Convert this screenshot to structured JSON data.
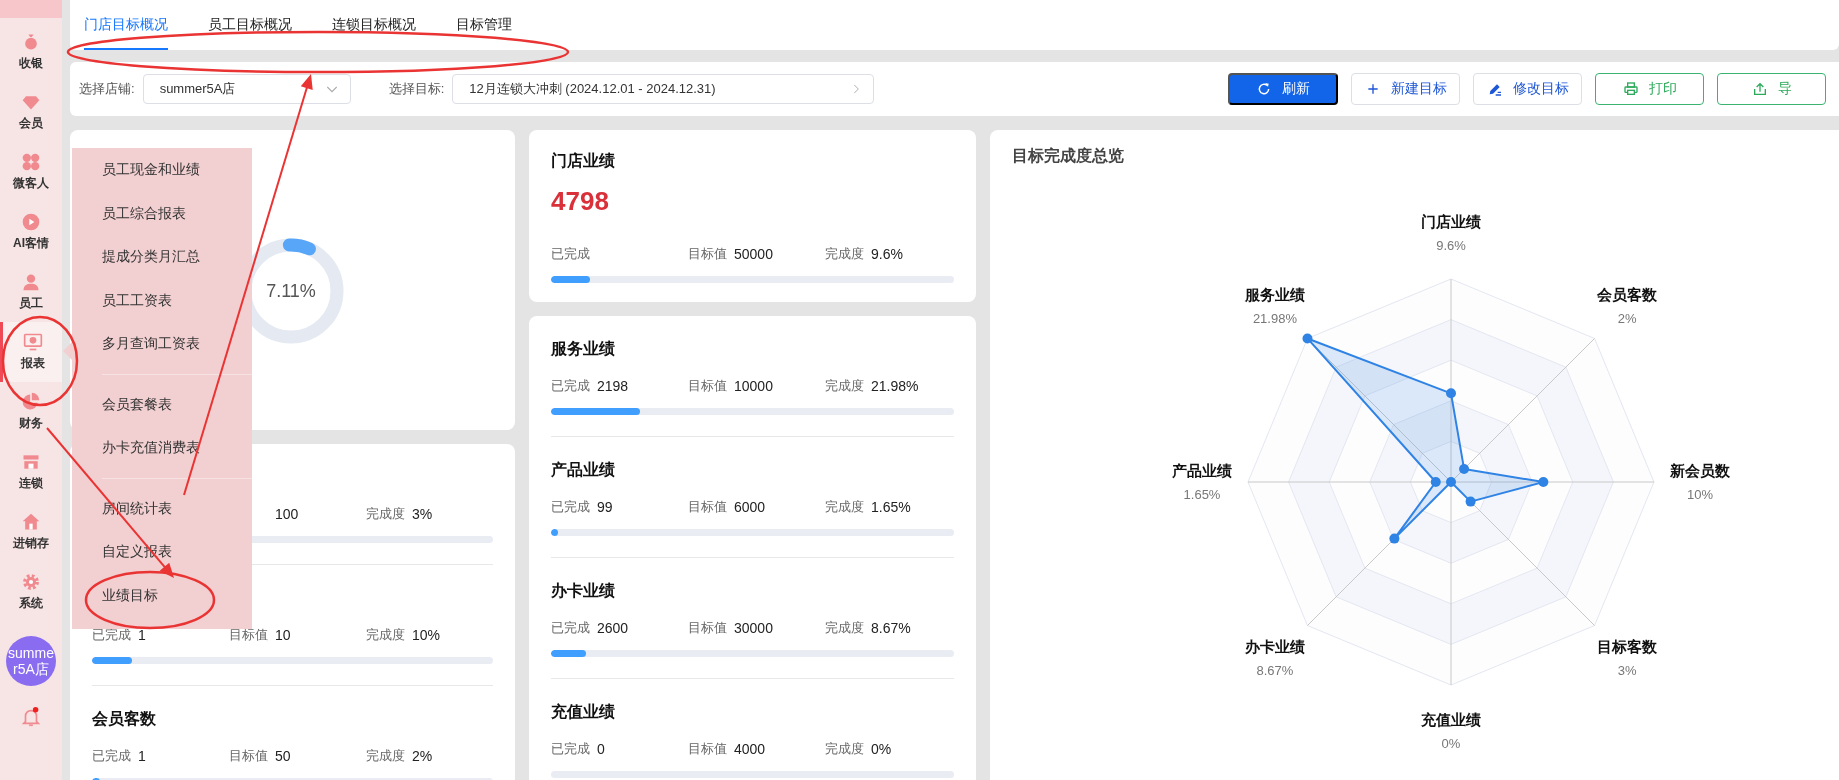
{
  "sidebar": {
    "items": [
      {
        "label": "收银",
        "selected": false
      },
      {
        "label": "会员",
        "selected": false
      },
      {
        "label": "微客人",
        "selected": false
      },
      {
        "label": "AI客情",
        "selected": false
      },
      {
        "label": "员工",
        "selected": false
      },
      {
        "label": "报表",
        "selected": true
      },
      {
        "label": "财务",
        "selected": false
      },
      {
        "label": "连锁",
        "selected": false
      },
      {
        "label": "进销存",
        "selected": false
      },
      {
        "label": "系统",
        "selected": false
      }
    ],
    "avatar": "summer5A店",
    "notification_dot": true
  },
  "tabs": [
    {
      "label": "门店目标概况",
      "selected": true
    },
    {
      "label": "员工目标概况",
      "selected": false
    },
    {
      "label": "连锁目标概况",
      "selected": false
    },
    {
      "label": "目标管理",
      "selected": false
    }
  ],
  "filters": [
    {
      "label": "选择店铺:",
      "value": "summer5A店",
      "kind": "dropdown"
    },
    {
      "label": "选择目标:",
      "value": "12月连锁大冲刺 (2024.12.01 - 2024.12.31)",
      "kind": "picker"
    }
  ],
  "buttons": [
    {
      "label": "刷新",
      "kind": "primary"
    },
    {
      "label": "新建目标",
      "kind": "plain"
    },
    {
      "label": "修改目标",
      "kind": "plain"
    },
    {
      "label": "打印",
      "kind": "success"
    },
    {
      "label": "导",
      "kind": "success"
    }
  ],
  "overall": {
    "percent": "7.11%",
    "level": 0.0711
  },
  "member_card": {
    "rows": [
      {
        "target": "100",
        "percent_label": "完成度",
        "percent": "3%",
        "level": 0.03
      },
      {
        "done_label": "已完成",
        "done": "1",
        "target_label": "目标值",
        "target": "10",
        "percent_label": "完成度",
        "percent": "10%",
        "level": 0.1
      },
      {
        "title": "会员客数",
        "done_label": "已完成",
        "done": "1",
        "target_label": "目标值",
        "target": "50",
        "percent_label": "完成度",
        "percent": "2%",
        "level": 0.02
      }
    ]
  },
  "store_card": {
    "title": "门店业绩",
    "amount": "4798",
    "rows": [
      {
        "done_label": "已完成",
        "target_label": "目标值",
        "target": "50000",
        "percent_label": "完成度",
        "percent": "9.6%",
        "level": 0.096
      }
    ]
  },
  "category_card": {
    "rows": [
      {
        "title": "服务业绩",
        "done_label": "已完成",
        "done": "2198",
        "target_label": "目标值",
        "target": "10000",
        "percent_label": "完成度",
        "percent": "21.98%",
        "level": 0.2198
      },
      {
        "title": "产品业绩",
        "done_label": "已完成",
        "done": "99",
        "target_label": "目标值",
        "target": "6000",
        "percent_label": "完成度",
        "percent": "1.65%",
        "level": 0.0165
      },
      {
        "title": "办卡业绩",
        "done_label": "已完成",
        "done": "2600",
        "target_label": "目标值",
        "target": "30000",
        "percent_label": "完成度",
        "percent": "8.67%",
        "level": 0.0867
      },
      {
        "title": "充值业绩",
        "done_label": "已完成",
        "done": "0",
        "target_label": "目标值",
        "target": "4000",
        "percent_label": "完成度",
        "percent": "0%",
        "level": 0
      }
    ]
  },
  "radar_card": {
    "title": "目标完成度总览",
    "axes": [
      {
        "label": "门店业绩",
        "value": "9.6%"
      },
      {
        "label": "会员客数",
        "value": "2%"
      },
      {
        "label": "新会员数",
        "value": "10%"
      },
      {
        "label": "目标客数",
        "value": "3%"
      },
      {
        "label": "充值业绩",
        "value": "0%"
      },
      {
        "label": "办卡业绩",
        "value": "8.67%"
      },
      {
        "label": "产品业绩",
        "value": "1.65%"
      },
      {
        "label": "服务业绩",
        "value": "21.98%"
      }
    ]
  },
  "popup_menu": {
    "groups": [
      [
        "员工现金和业绩",
        "员工综合报表",
        "提成分类月汇总",
        "员工工资表",
        "多月查询工资表"
      ],
      [
        "会员套餐表",
        "办卡充值消费表"
      ],
      [
        "房间统计表",
        "自定义报表",
        "业绩目标"
      ]
    ]
  },
  "annotations": [
    {
      "kind": "ellipse"
    },
    {
      "kind": "ellipse"
    },
    {
      "kind": "ellipse"
    },
    {
      "kind": "arrow"
    },
    {
      "kind": "arrow"
    }
  ]
}
